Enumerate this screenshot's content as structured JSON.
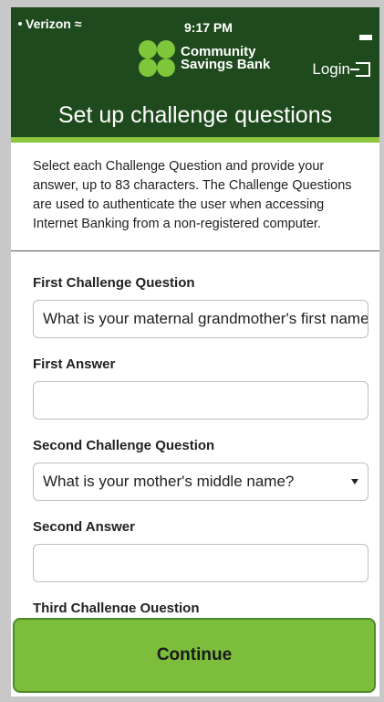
{
  "status_bar": {
    "carrier": "Verizon",
    "time": "9:17 PM"
  },
  "header": {
    "brand_line1": "Community",
    "brand_line2": "Savings Bank",
    "login_label": "Login",
    "brand_color": "#1f4a1d",
    "accent_color": "#8dc63f"
  },
  "page": {
    "title": "Set up challenge questions",
    "intro": "Select each Challenge Question and provide your answer, up to 83 characters. The Challenge Questions are used to authenticate the user when accessing Internet Banking from a non-registered computer."
  },
  "form": {
    "q1_label": "First Challenge Question",
    "q1_value": "What is your maternal grandmother's first name?",
    "a1_label": "First Answer",
    "a1_value": "",
    "q2_label": "Second Challenge Question",
    "q2_value": "What is your mother's middle name?",
    "a2_label": "Second Answer",
    "a2_value": "",
    "q3_label": "Third Challenge Question"
  },
  "footer": {
    "continue_label": "Continue"
  }
}
